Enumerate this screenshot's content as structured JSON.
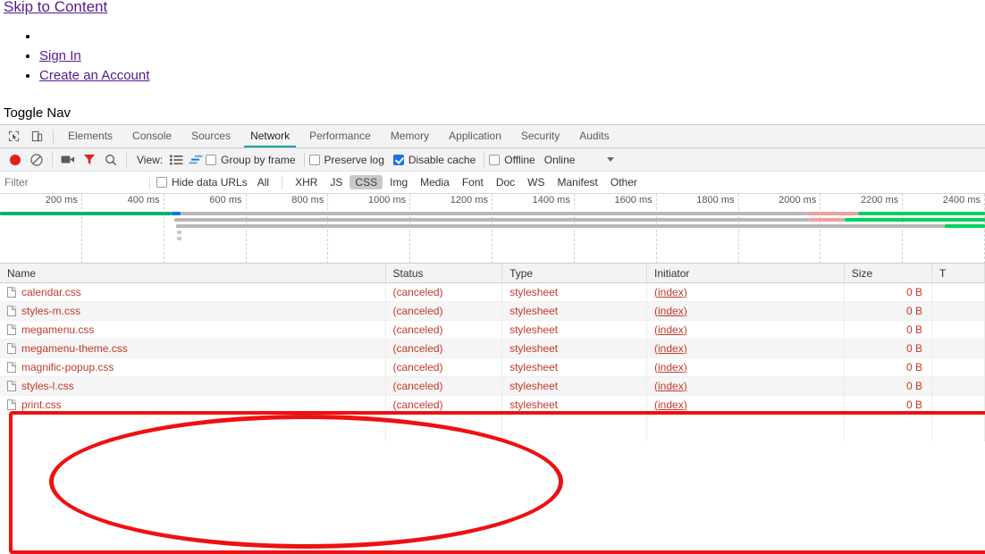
{
  "page": {
    "skip_link": "Skip to Content",
    "nav_items": [
      "",
      "Sign In",
      "Create an Account"
    ],
    "toggle_nav": "Toggle Nav"
  },
  "devtools": {
    "left_icons": [
      {
        "name": "inspect-element-icon",
        "glyph": "inspect"
      },
      {
        "name": "device-toolbar-icon",
        "glyph": "device"
      }
    ],
    "tabs": [
      {
        "label": "Elements",
        "active": false
      },
      {
        "label": "Console",
        "active": false
      },
      {
        "label": "Sources",
        "active": false
      },
      {
        "label": "Network",
        "active": true
      },
      {
        "label": "Performance",
        "active": false
      },
      {
        "label": "Memory",
        "active": false
      },
      {
        "label": "Application",
        "active": false
      },
      {
        "label": "Security",
        "active": false
      },
      {
        "label": "Audits",
        "active": false
      }
    ],
    "active_tab_underline_color": "#17a0a8",
    "network_toolbar": {
      "record_label": "record-button",
      "clear_label": "clear-button",
      "screenshot_label": "capture-screenshots-button",
      "filter_label": "filter-button",
      "search_label": "search-button",
      "view_label": "View:",
      "view_list_label": "list-view-button",
      "view_waterfall_label": "waterfall-view-button",
      "group_by_frame": {
        "label": "Group by frame",
        "checked": false
      },
      "preserve_log": {
        "label": "Preserve log",
        "checked": false
      },
      "disable_cache": {
        "label": "Disable cache",
        "checked": true
      },
      "offline": {
        "label": "Offline",
        "checked": false
      },
      "throttling": {
        "label": "Online"
      }
    },
    "filter_bar": {
      "placeholder": "Filter",
      "value": "",
      "hide_data_urls": {
        "label": "Hide data URLs",
        "checked": false
      },
      "types": [
        {
          "label": "All",
          "active": false
        },
        {
          "label": "XHR",
          "active": false
        },
        {
          "label": "JS",
          "active": false
        },
        {
          "label": "CSS",
          "active": true
        },
        {
          "label": "Img",
          "active": false
        },
        {
          "label": "Media",
          "active": false
        },
        {
          "label": "Font",
          "active": false
        },
        {
          "label": "Doc",
          "active": false
        },
        {
          "label": "WS",
          "active": false
        },
        {
          "label": "Manifest",
          "active": false
        },
        {
          "label": "Other",
          "active": false
        }
      ]
    },
    "overview": {
      "ticks": [
        "200 ms",
        "400 ms",
        "600 ms",
        "800 ms",
        "1000 ms",
        "1200 ms",
        "1400 ms",
        "1600 ms",
        "1800 ms",
        "2000 ms",
        "2200 ms",
        "2400 ms"
      ]
    },
    "requests_table": {
      "columns": [
        "Name",
        "Status",
        "Type",
        "Initiator",
        "Size",
        "T"
      ],
      "rows": [
        {
          "name": "calendar.css",
          "status": "(canceled)",
          "type": "stylesheet",
          "initiator": "(index)",
          "size": "0 B",
          "time": ""
        },
        {
          "name": "styles-m.css",
          "status": "(canceled)",
          "type": "stylesheet",
          "initiator": "(index)",
          "size": "0 B",
          "time": ""
        },
        {
          "name": "megamenu.css",
          "status": "(canceled)",
          "type": "stylesheet",
          "initiator": "(index)",
          "size": "0 B",
          "time": ""
        },
        {
          "name": "megamenu-theme.css",
          "status": "(canceled)",
          "type": "stylesheet",
          "initiator": "(index)",
          "size": "0 B",
          "time": ""
        },
        {
          "name": "magnific-popup.css",
          "status": "(canceled)",
          "type": "stylesheet",
          "initiator": "(index)",
          "size": "0 B",
          "time": ""
        },
        {
          "name": "styles-l.css",
          "status": "(canceled)",
          "type": "stylesheet",
          "initiator": "(index)",
          "size": "0 B",
          "time": ""
        },
        {
          "name": "print.css",
          "status": "(canceled)",
          "type": "stylesheet",
          "initiator": "(index)",
          "size": "0 B",
          "time": ""
        }
      ]
    },
    "annotations": {
      "color": "#ee1111",
      "shapes": [
        "rectangle-around-canceled-requests",
        "ellipse-around-request-names"
      ]
    },
    "colors": {
      "error_text": "#c0392b",
      "link": "#551a8b",
      "accent": "#1a73e8",
      "record": "#e02020"
    }
  }
}
